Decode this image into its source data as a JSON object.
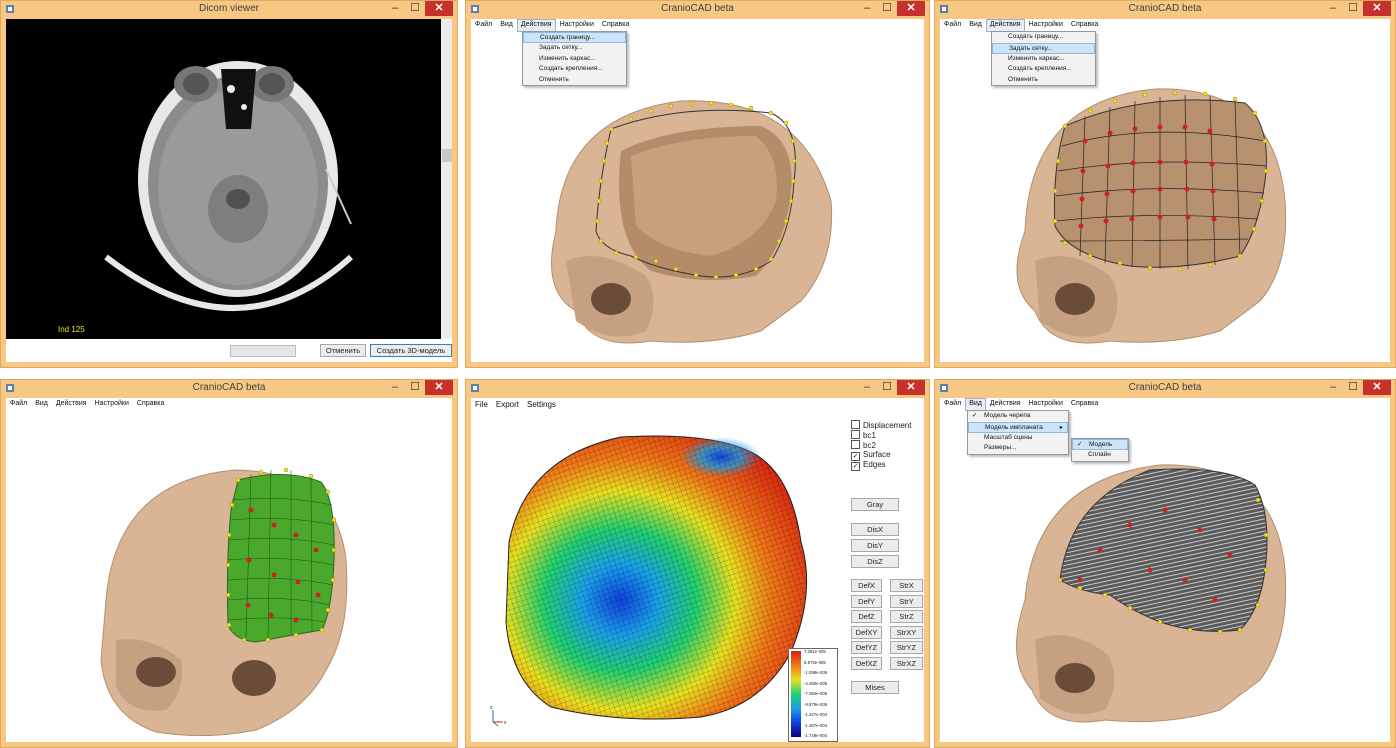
{
  "w1": {
    "title": "Dicom viewer",
    "slice_label": "Ind 125",
    "cancel_label": "Отменить",
    "create_label": "Создать 3D-модель"
  },
  "w2": {
    "title": "CranioCAD beta",
    "menu": [
      "Файл",
      "Вид",
      "Действия",
      "Настройки",
      "Справка"
    ],
    "dropdown": [
      "Создать границу...",
      "Задать сетку...",
      "Изменить каркас...",
      "Создать крепления...",
      "Отменить"
    ]
  },
  "w3": {
    "title": "CranioCAD beta",
    "menu": [
      "Файл",
      "Вид",
      "Действия",
      "Настройки",
      "Справка"
    ],
    "dropdown": [
      "Создать границу...",
      "Задать сетку...",
      "Изменить каркас...",
      "Создать крепления...",
      "Отменить"
    ]
  },
  "w4": {
    "title": "CranioCAD beta",
    "menu": [
      "Файл",
      "Вид",
      "Действия",
      "Настройки",
      "Справка"
    ]
  },
  "w5": {
    "menu": [
      "File",
      "Export",
      "Settings"
    ],
    "checkboxes": [
      {
        "label": "Displacement",
        "checked": false
      },
      {
        "label": "bc1",
        "checked": false
      },
      {
        "label": "bc2",
        "checked": false
      },
      {
        "label": "Surface",
        "checked": true
      },
      {
        "label": "Edges",
        "checked": true
      }
    ],
    "buttons": {
      "gray": "Gray",
      "dis": [
        "DisX",
        "DisY",
        "DisZ"
      ],
      "def": [
        "DefX",
        "DefY",
        "DefZ",
        "DefXY",
        "DefYZ",
        "DefXZ"
      ],
      "str": [
        "StrX",
        "StrY",
        "StrZ",
        "StrXY",
        "StrYZ",
        "StrXZ"
      ],
      "mises": "Mises"
    },
    "legend": [
      "7.281e-005",
      "5.973e-005",
      "-1.098e-005",
      "-4.480e-005",
      "-7.094e-005",
      "-9.879e-005",
      "-1.227e-004",
      "-1.487e-004",
      "-1.748e-004"
    ],
    "axis_labels": [
      "z",
      "x"
    ]
  },
  "w6": {
    "title": "CranioCAD beta",
    "menu": [
      "Файл",
      "Вид",
      "Действия",
      "Настройки",
      "Справка"
    ],
    "dropdown": [
      "Модель черепа",
      "Модель импланата",
      "Масштаб сцены",
      "Размеры..."
    ],
    "submenu": [
      "Модель",
      "Сплайн"
    ],
    "check": "✓",
    "submenu_arrow": "▸"
  },
  "colors": {
    "frame": "#f7c883",
    "close": "#c7312b",
    "bone": "#d9b596",
    "implant_green": "#4aa82c",
    "point_yellow": "#f5e22b",
    "point_red": "#cc2222"
  }
}
